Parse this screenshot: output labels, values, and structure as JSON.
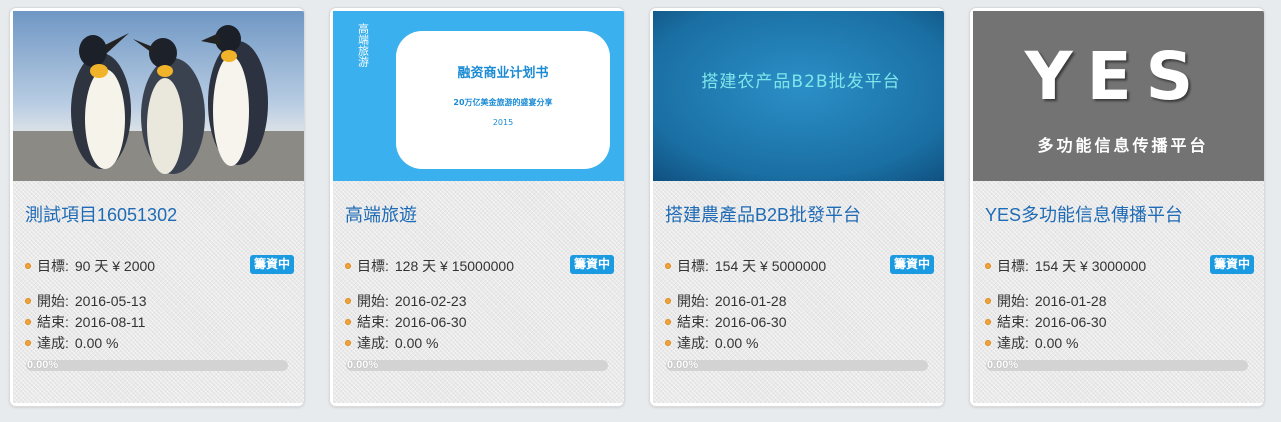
{
  "labels": {
    "target": "目標:",
    "start": "開始:",
    "end": "結束:",
    "achieved": "達成:"
  },
  "cards": [
    {
      "title": "測試項目16051302",
      "target_text": "90 天 ¥ 2000",
      "badge": "籌資中",
      "start": "2016-05-13",
      "end": "2016-08-11",
      "achieved": "0.00 %",
      "progress_text": "0.00%",
      "progress_fraction": 0,
      "image": {
        "type": "photo",
        "icon": "penguins-photo"
      }
    },
    {
      "title": "高端旅遊",
      "target_text": "128 天 ¥ 15000000",
      "badge": "籌資中",
      "start": "2016-02-23",
      "end": "2016-06-30",
      "achieved": "0.00 %",
      "progress_text": "0.00%",
      "progress_fraction": 0,
      "image": {
        "vertical_text": "高端旅游",
        "heading": "融资商业计划书",
        "subheading": "20万亿美金旅游的盛宴分享",
        "year": "2015",
        "bg": "#3ab0ee"
      }
    },
    {
      "title": "搭建農產品B2B批發平台",
      "target_text": "154 天 ¥ 5000000",
      "badge": "籌資中",
      "start": "2016-01-28",
      "end": "2016-06-30",
      "achieved": "0.00 %",
      "progress_text": "0.00%",
      "progress_fraction": 0,
      "image": {
        "heading": "搭建农产品B2B批发平台",
        "bg": "#1e7cb0"
      }
    },
    {
      "title": "YES多功能信息傳播平台",
      "target_text": "154 天 ¥ 3000000",
      "badge": "籌資中",
      "start": "2016-01-28",
      "end": "2016-06-30",
      "achieved": "0.00 %",
      "progress_text": "0.00%",
      "progress_fraction": 0,
      "image": {
        "big": "YES",
        "heading": "多功能信息传播平台",
        "bg": "#737373"
      }
    }
  ],
  "colors": {
    "title": "#1f6bb5",
    "badge": "#1a9ae0",
    "bullet": "#f0a33c"
  }
}
